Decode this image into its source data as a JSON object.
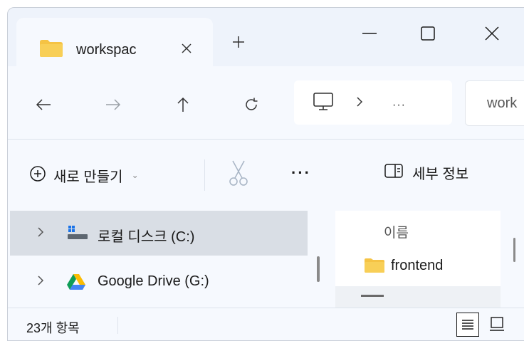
{
  "tab": {
    "title": "workspac",
    "icon": "folder-icon"
  },
  "window_controls": {
    "minimize": "minimize-icon",
    "maximize": "maximize-icon",
    "close": "close-icon"
  },
  "nav": {
    "back": "back-arrow-icon",
    "forward": "forward-arrow-icon",
    "up": "up-arrow-icon",
    "refresh": "refresh-icon",
    "address_more": "···",
    "search_text": "work"
  },
  "commands": {
    "new_label": "새로 만들기",
    "new_caret": "⌄",
    "more": "···",
    "details_label": "세부 정보"
  },
  "sidebar": {
    "items": [
      {
        "label": "로컬 디스크 (C:)",
        "icon": "local-disk-icon",
        "selected": true
      },
      {
        "label": "Google Drive (G:)",
        "icon": "google-drive-icon",
        "selected": false
      }
    ]
  },
  "files": {
    "column_name": "이름",
    "rows": [
      {
        "name": "frontend",
        "icon": "folder-icon"
      }
    ]
  },
  "status": {
    "item_count": "23개 항목"
  },
  "colors": {
    "window_bg": "#eef3fb",
    "pane_bg": "#f6f9fe",
    "selected_bg": "#d9dee5",
    "folder": "#f5c344"
  }
}
